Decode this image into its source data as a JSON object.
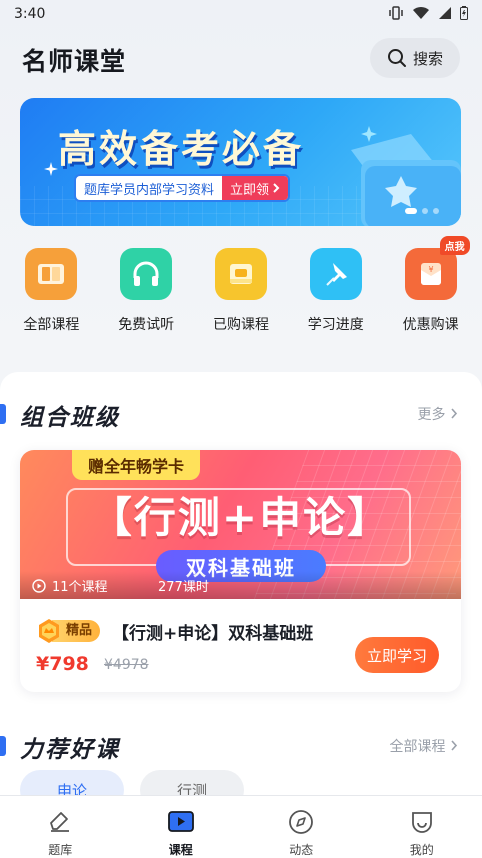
{
  "status_bar": {
    "time": "3:40"
  },
  "header": {
    "title": "名师课堂",
    "search_label": "搜索"
  },
  "banner": {
    "title": "高效备考必备",
    "subtitle": "题库学员内部学习资料",
    "cta": "立即领"
  },
  "quick_menu": [
    {
      "label": "全部课程",
      "color": "#f6a03a"
    },
    {
      "label": "免费试听",
      "color": "#2fd2a6"
    },
    {
      "label": "已购课程",
      "color": "#f7c52d"
    },
    {
      "label": "学习进度",
      "color": "#2fc0f5"
    },
    {
      "label": "优惠购课",
      "color": "#f46a3a",
      "badge": "点我"
    }
  ],
  "combo_section": {
    "title": "组合班级",
    "more": "更多",
    "course": {
      "ribbon": "赠全年畅学卡",
      "cover_title": "【行测+申论】",
      "cover_subtitle": "双科基础班",
      "lessons": "11个课程",
      "hours": "277课时",
      "badge": "精品",
      "name": "【行测+申论】双科基础班",
      "price": "¥798",
      "original_price": "¥4978",
      "cta": "立即学习"
    }
  },
  "recommend_section": {
    "title": "力荐好课",
    "more": "全部课程",
    "tabs": [
      "申论",
      "行测"
    ]
  },
  "tab_bar": [
    {
      "label": "题库",
      "icon": "question-bank-icon"
    },
    {
      "label": "课程",
      "icon": "course-icon",
      "active": true
    },
    {
      "label": "动态",
      "icon": "compass-icon"
    },
    {
      "label": "我的",
      "icon": "profile-icon"
    }
  ],
  "colors": {
    "accent": "#2f6ff2",
    "price": "#f03a2e",
    "cta": "#ff6a33"
  }
}
